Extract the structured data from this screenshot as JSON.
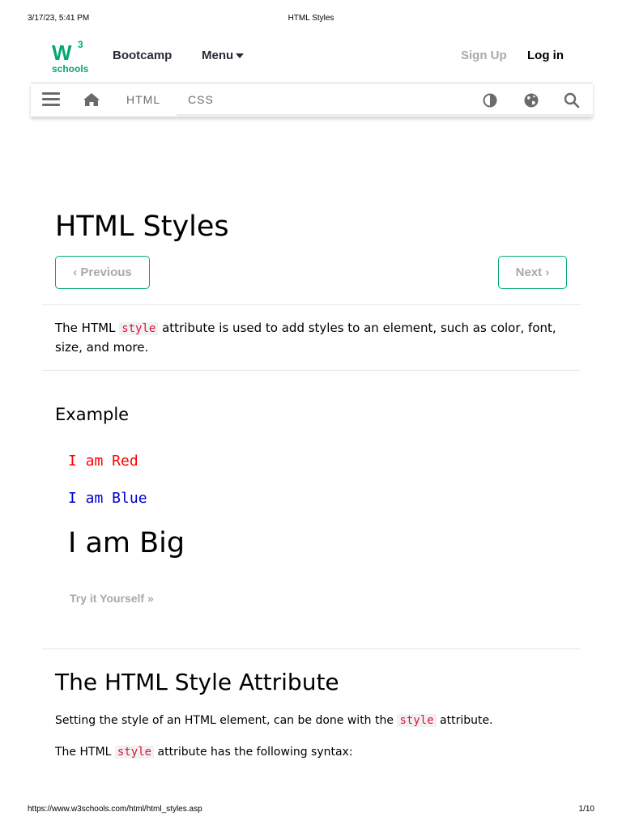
{
  "print_header": {
    "date": "3/17/23, 5:41 PM",
    "title": "HTML Styles"
  },
  "print_footer": {
    "url": "https://www.w3schools.com/html/html_styles.asp",
    "page": "1/10"
  },
  "topbar": {
    "logo": {
      "mark": "W",
      "superscript": "3",
      "text": "schools",
      "icon": "w3schools-logo"
    },
    "bootcamp": "Bootcamp",
    "menu": "Menu",
    "signup": "Sign Up",
    "login": "Log in"
  },
  "navbar": {
    "icons": [
      "hamburger-icon",
      "home-icon",
      "contrast-icon",
      "globe-icon",
      "search-icon"
    ],
    "tabs": [
      {
        "label": "HTML"
      },
      {
        "label": "CSS"
      }
    ]
  },
  "main": {
    "title": "HTML Styles",
    "prev_label": "Previous",
    "next_label": "Next",
    "intro": {
      "before": "The HTML ",
      "code": "style",
      "after": " attribute is used to add styles to an element, such as color, font, size, and more."
    },
    "example": {
      "title": "Example",
      "red": "I am Red",
      "blue": "I am Blue",
      "big": "I am Big",
      "try": "Try it Yourself »"
    },
    "section": {
      "title": "The HTML Style Attribute",
      "p1": {
        "before": "Setting the style of an HTML element, can be done with the ",
        "code": "style",
        "after": " attribute."
      },
      "p2": {
        "before": "The HTML ",
        "code": "style",
        "after": " attribute has the following syntax:"
      }
    }
  },
  "colors": {
    "accent": "#04AA6D",
    "code": "#dc143c",
    "red": "#ff0000",
    "blue": "#0000cd",
    "muted": "#a9a9a9"
  }
}
